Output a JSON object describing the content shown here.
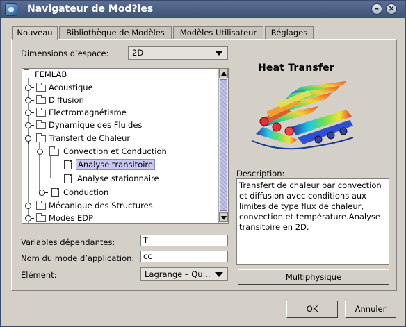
{
  "window": {
    "title": "Navigateur de Mod?les",
    "minimize_glyph": "–",
    "close_glyph": "×"
  },
  "tabs": [
    {
      "label": "Nouveau",
      "active": true
    },
    {
      "label": "Bibliothèque de Modèles",
      "active": false
    },
    {
      "label": "Modèles Utilisateur",
      "active": false
    },
    {
      "label": "Réglages",
      "active": false
    }
  ],
  "dimensions": {
    "label": "Dimensions d’espace:",
    "value": "2D"
  },
  "tree": {
    "root": "FEMLAB",
    "items": [
      "Acoustique",
      "Diffusion",
      "Electromagnétisme",
      "Dynamique des Fluides",
      "Transfert de Chaleur",
      "Convection et Conduction",
      "Analyse transitoire",
      "Analyse stationnaire",
      "Conduction",
      "Mécanique des Structures",
      "Modes EDP"
    ]
  },
  "form": {
    "dep_vars_label": "Variables dépendantes:",
    "dep_vars_value": "T",
    "mode_name_label": "Nom du mode d’application:",
    "mode_name_value": "cc",
    "element_label": "Élément:",
    "element_value": "Lagrange – Qu..."
  },
  "preview": {
    "title": "Heat Transfer",
    "image": "heat-transfer-3d-plot"
  },
  "description": {
    "label": "Description:",
    "text": "Transfert de chaleur par convection et diffusion avec conditions aux limites de type flux de chaleur, convection et température.Analyse transitoire en 2D."
  },
  "buttons": {
    "multiphysics": "Multiphysique",
    "ok": "OK",
    "cancel": "Annuler"
  },
  "colors": {
    "titlebar": "#4a5f86",
    "selection": "#c8c8f0",
    "dialog": "#d4d0c8"
  }
}
